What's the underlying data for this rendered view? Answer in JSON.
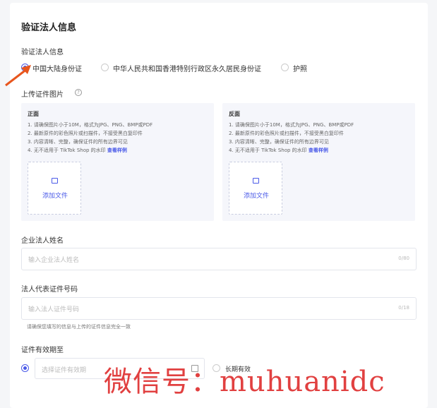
{
  "title": "验证法人信息",
  "id_section": {
    "label": "验证法人信息",
    "options": [
      "中国大陆身份证",
      "中华人民共和国香港特别行政区永久居民身份证",
      "护照"
    ],
    "selected": 0
  },
  "upload": {
    "label": "上传证件图片",
    "help_icon": "question-circle-icon",
    "front": {
      "title": "正面",
      "lines": [
        "1. 请确保图片小于10M，格式为JPG、PNG、BMP或PDF",
        "2. 最新原件的彩色照片或扫描件，不接受黑白复印件",
        "3. 内容清晰、完整，确保证件的所有边界可见",
        "4. 无不适用于 TikTok Shop 的水印"
      ],
      "link": "查看样例",
      "button": "添加文件",
      "icon": "image-icon"
    },
    "back": {
      "title": "反面",
      "lines": [
        "1. 请确保图片小于10M，格式为JPG、PNG、BMP或PDF",
        "2. 最新原件的彩色照片或扫描件，不接受黑白复印件",
        "3. 内容清晰、完整，确保证件的所有边界可见",
        "4. 无不适用于 TikTok Shop 的水印"
      ],
      "link": "查看样例",
      "button": "添加文件",
      "icon": "image-icon"
    }
  },
  "name": {
    "label": "企业法人姓名",
    "placeholder": "输入企业法人姓名",
    "count": "0/80"
  },
  "idno": {
    "label": "法人代表证件号码",
    "placeholder": "输入法人证件号码",
    "count": "0/18",
    "hint": "请确保您填写的信息与上传的证件信息完全一致"
  },
  "expiry": {
    "label": "证件有效期至",
    "placeholder": "选择证件有效期",
    "long": "长期有效",
    "icon": "calendar-icon"
  },
  "watermark": "微信号：muhuanidc",
  "colors": {
    "accent": "#4a5ae8",
    "arrow": "#e8561e"
  }
}
